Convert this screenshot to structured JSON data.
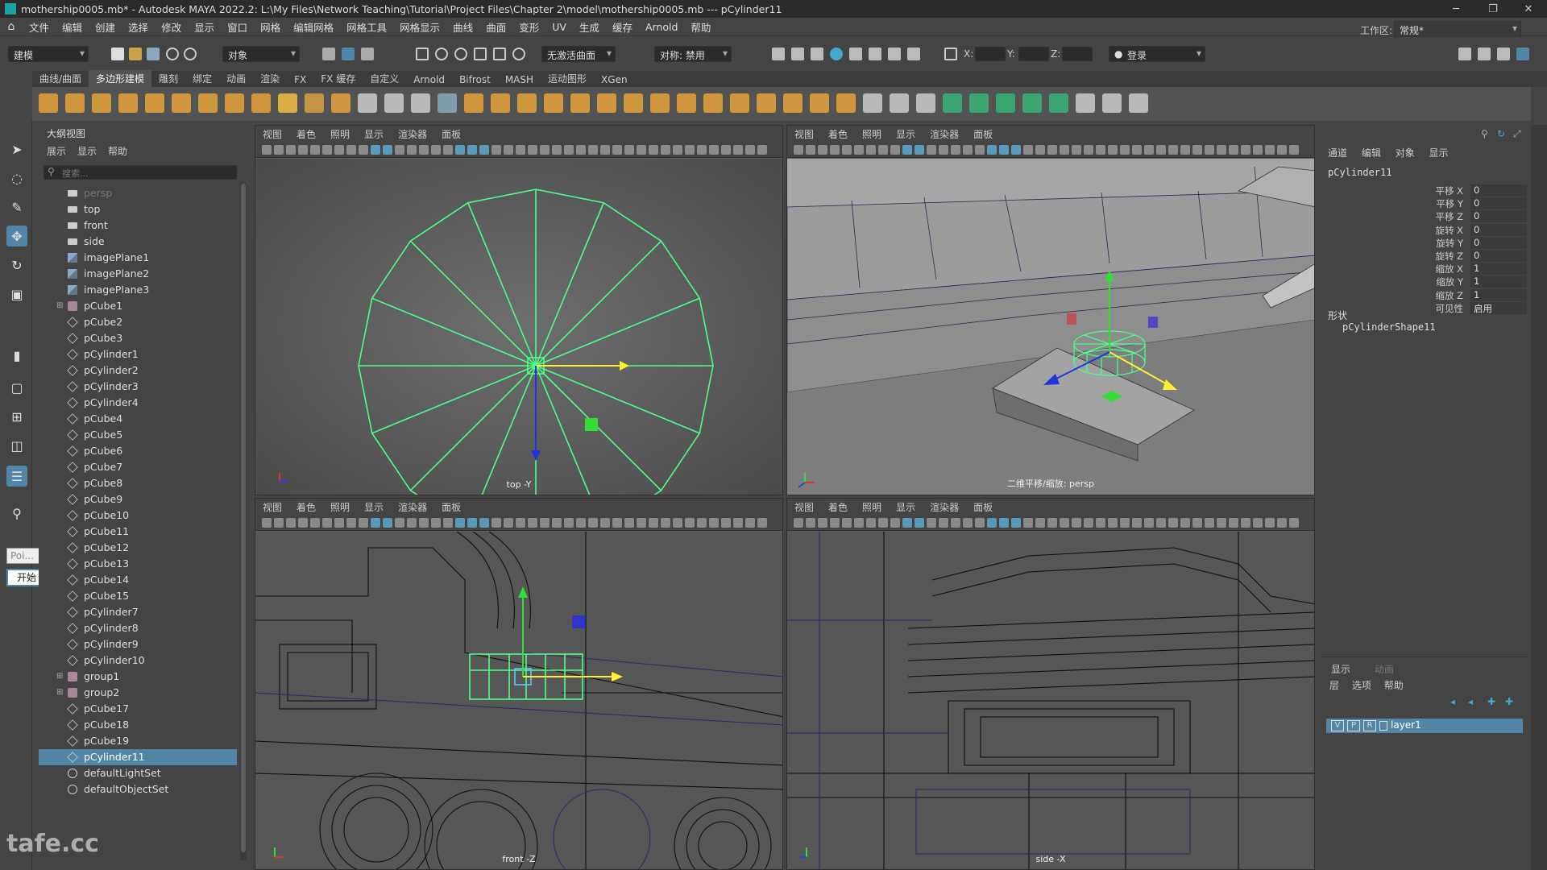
{
  "window": {
    "title": "mothership0005.mb* - Autodesk MAYA 2022.2: L:\\My Files\\Network Teaching\\Tutorial\\Project Files\\Chapter 2\\model\\mothership0005.mb   ---   pCylinder11",
    "minimize": "─",
    "restore": "❐",
    "close": "✕"
  },
  "menubar": [
    "文件",
    "编辑",
    "创建",
    "选择",
    "修改",
    "显示",
    "窗口",
    "网格",
    "编辑网格",
    "网格工具",
    "网格显示",
    "曲线",
    "曲面",
    "变形",
    "UV",
    "生成",
    "缓存",
    "Arnold",
    "帮助"
  ],
  "statusline": {
    "mode": "建模",
    "select_mode": "对象",
    "live_surface": "无激活曲面",
    "symmetry": "对称: 禁用",
    "x_label": "X:",
    "y_label": "Y:",
    "z_label": "Z:",
    "login": "登录",
    "workspace_label": "工作区:",
    "workspace": "常规*"
  },
  "shelf": {
    "tabs": [
      "曲线/曲面",
      "多边形建模",
      "雕刻",
      "绑定",
      "动画",
      "渲染",
      "FX",
      "FX 缓存",
      "自定义",
      "Arnold",
      "Bifrost",
      "MASH",
      "运动图形",
      "XGen"
    ],
    "active_tab": 1
  },
  "toolbox": {
    "poly_field": "Poi...",
    "start_button": "开始"
  },
  "outliner": {
    "title": "大纲视图",
    "menu": [
      "展示",
      "显示",
      "帮助"
    ],
    "search_placeholder": "搜索...",
    "items": [
      {
        "label": "persp",
        "type": "cam",
        "dim": true
      },
      {
        "label": "top",
        "type": "cam"
      },
      {
        "label": "front",
        "type": "cam"
      },
      {
        "label": "side",
        "type": "cam"
      },
      {
        "label": "imagePlane1",
        "type": "img"
      },
      {
        "label": "imagePlane2",
        "type": "img"
      },
      {
        "label": "imagePlane3",
        "type": "img"
      },
      {
        "label": "pCube1",
        "type": "grp",
        "expand": true
      },
      {
        "label": "pCube2",
        "type": "mesh"
      },
      {
        "label": "pCube3",
        "type": "mesh"
      },
      {
        "label": "pCylinder1",
        "type": "mesh"
      },
      {
        "label": "pCylinder2",
        "type": "mesh"
      },
      {
        "label": "pCylinder3",
        "type": "mesh"
      },
      {
        "label": "pCylinder4",
        "type": "mesh"
      },
      {
        "label": "pCube4",
        "type": "mesh"
      },
      {
        "label": "pCube5",
        "type": "mesh"
      },
      {
        "label": "pCube6",
        "type": "mesh"
      },
      {
        "label": "pCube7",
        "type": "mesh"
      },
      {
        "label": "pCube8",
        "type": "mesh"
      },
      {
        "label": "pCube9",
        "type": "mesh"
      },
      {
        "label": "pCube10",
        "type": "mesh"
      },
      {
        "label": "pCube11",
        "type": "mesh"
      },
      {
        "label": "pCube12",
        "type": "mesh"
      },
      {
        "label": "pCube13",
        "type": "mesh"
      },
      {
        "label": "pCube14",
        "type": "mesh"
      },
      {
        "label": "pCube15",
        "type": "mesh"
      },
      {
        "label": "pCylinder7",
        "type": "mesh"
      },
      {
        "label": "pCylinder8",
        "type": "mesh"
      },
      {
        "label": "pCylinder9",
        "type": "mesh"
      },
      {
        "label": "pCylinder10",
        "type": "mesh"
      },
      {
        "label": "group1",
        "type": "grp",
        "expand": true
      },
      {
        "label": "group2",
        "type": "grp",
        "expand": true
      },
      {
        "label": "pCube17",
        "type": "mesh"
      },
      {
        "label": "pCube18",
        "type": "mesh"
      },
      {
        "label": "pCube19",
        "type": "mesh"
      },
      {
        "label": "pCylinder11",
        "type": "mesh",
        "selected": true
      },
      {
        "label": "defaultLightSet",
        "type": "set"
      },
      {
        "label": "defaultObjectSet",
        "type": "set"
      }
    ]
  },
  "viewports": {
    "menu": [
      "视图",
      "着色",
      "照明",
      "显示",
      "渲染器",
      "面板"
    ],
    "top_label": "top -Y",
    "persp_label": "二维平移/缩放: persp",
    "front_label": "front -Z",
    "side_label": "side -X"
  },
  "channelbox": {
    "tabs": [
      "通道",
      "编辑",
      "对象",
      "显示"
    ],
    "object": "pCylinder11",
    "attributes": [
      {
        "name": "平移 X",
        "value": "0"
      },
      {
        "name": "平移 Y",
        "value": "0"
      },
      {
        "name": "平移 Z",
        "value": "0"
      },
      {
        "name": "旋转 X",
        "value": "0"
      },
      {
        "name": "旋转 Y",
        "value": "0"
      },
      {
        "name": "旋转 Z",
        "value": "0"
      },
      {
        "name": "缩放 X",
        "value": "1"
      },
      {
        "name": "缩放 Y",
        "value": "1"
      },
      {
        "name": "缩放 Z",
        "value": "1"
      },
      {
        "name": "可见性",
        "value": "启用"
      }
    ],
    "shapes_label": "形状",
    "shape_name": "pCylinderShape11",
    "layer_tabs": [
      "显示",
      "动画"
    ],
    "layer_menu": [
      "层",
      "选项",
      "帮助"
    ],
    "layer": {
      "v": "V",
      "p": "P",
      "r": "R",
      "name": "layer1"
    }
  },
  "watermark": "tafe.cc",
  "colors": {
    "accent": "#5285a6",
    "wire_selected": "#4dff88",
    "manip_x": "#ffee33",
    "manip_y": "#33dd33",
    "manip_z": "#2233dd"
  }
}
